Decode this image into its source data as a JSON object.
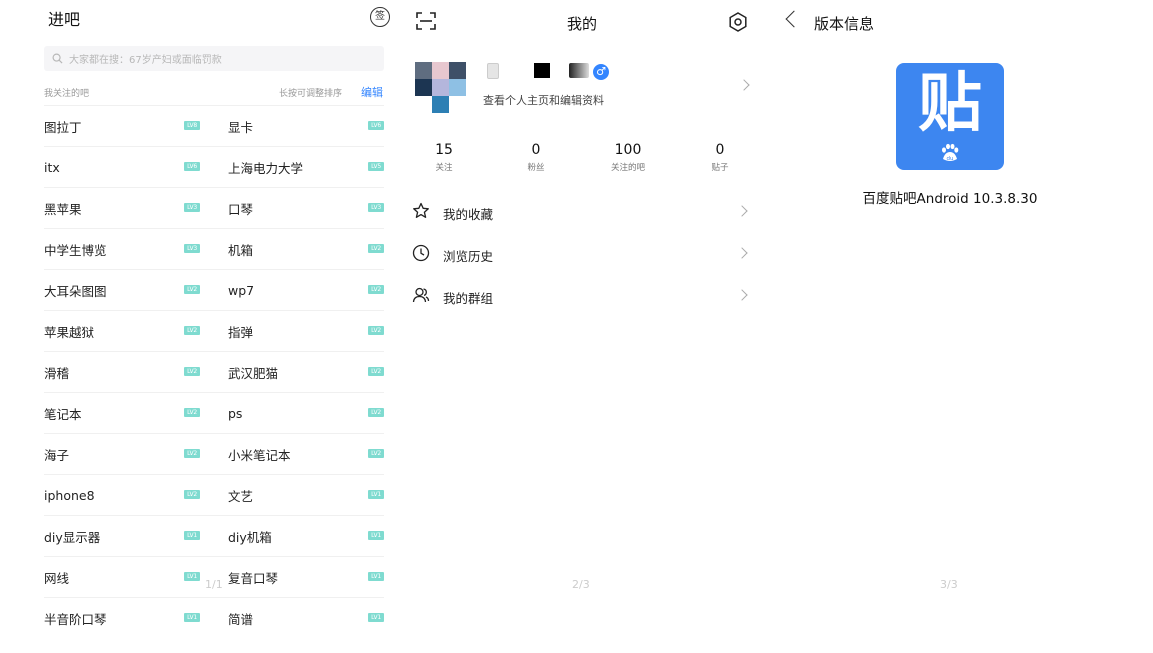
{
  "followed_bars": {
    "title": "进吧",
    "sign_icon_label": "签",
    "search_placeholder": "大家都在搜：67岁产妇或面临罚款",
    "section_title": "我关注的吧",
    "sort_hint": "长按可调整排序",
    "edit_label": "编辑",
    "rows": [
      [
        {
          "name": "图拉丁",
          "level": "LV8"
        },
        {
          "name": "显卡",
          "level": "LV6"
        }
      ],
      [
        {
          "name": "itx",
          "level": "LV6"
        },
        {
          "name": "上海电力大学",
          "level": "LV5"
        }
      ],
      [
        {
          "name": "黑苹果",
          "level": "LV3"
        },
        {
          "name": "口琴",
          "level": "LV3"
        }
      ],
      [
        {
          "name": "中学生博览",
          "level": "LV3"
        },
        {
          "name": "机箱",
          "level": "LV2"
        }
      ],
      [
        {
          "name": "大耳朵图图",
          "level": "LV2"
        },
        {
          "name": "wp7",
          "level": "LV2"
        }
      ],
      [
        {
          "name": "苹果越狱",
          "level": "LV2"
        },
        {
          "name": "指弹",
          "level": "LV2"
        }
      ],
      [
        {
          "name": "滑稽",
          "level": "LV2"
        },
        {
          "name": "武汉肥猫",
          "level": "LV2"
        }
      ],
      [
        {
          "name": "笔记本",
          "level": "LV2"
        },
        {
          "name": "ps",
          "level": "LV2"
        }
      ],
      [
        {
          "name": "海子",
          "level": "LV2"
        },
        {
          "name": "小米笔记本",
          "level": "LV2"
        }
      ],
      [
        {
          "name": "iphone8",
          "level": "LV2"
        },
        {
          "name": "文艺",
          "level": "LV1"
        }
      ],
      [
        {
          "name": "diy显示器",
          "level": "LV1"
        },
        {
          "name": "diy机箱",
          "level": "LV1"
        }
      ],
      [
        {
          "name": "网线",
          "level": "LV1"
        },
        {
          "name": "复音口琴",
          "level": "LV1"
        }
      ],
      [
        {
          "name": "半音阶口琴",
          "level": "LV1"
        },
        {
          "name": "简谱",
          "level": "LV1"
        }
      ]
    ],
    "page_indicator": "1/1"
  },
  "profile": {
    "title": "我的",
    "profile_link_text": "查看个人主页和编辑资料",
    "gender_symbol": "♂",
    "stats": [
      {
        "value": "15",
        "label": "关注"
      },
      {
        "value": "0",
        "label": "粉丝"
      },
      {
        "value": "100",
        "label": "关注的吧"
      },
      {
        "value": "0",
        "label": "贴子"
      }
    ],
    "menu": [
      {
        "label": "我的收藏",
        "icon": "star-icon"
      },
      {
        "label": "浏览历史",
        "icon": "clock-icon"
      },
      {
        "label": "我的群组",
        "icon": "group-icon"
      }
    ],
    "page_indicator": "2/3"
  },
  "version_info": {
    "title": "版本信息",
    "logo_glyph": "贴",
    "logo_badge": "du",
    "app_version": "百度贴吧Android 10.3.8.30",
    "page_indicator": "3/3"
  },
  "colors": {
    "accent": "#3385ff",
    "level_badge": "#7fdbd0",
    "logo_bg": "#3d86f0",
    "gender": "#3385ff"
  }
}
